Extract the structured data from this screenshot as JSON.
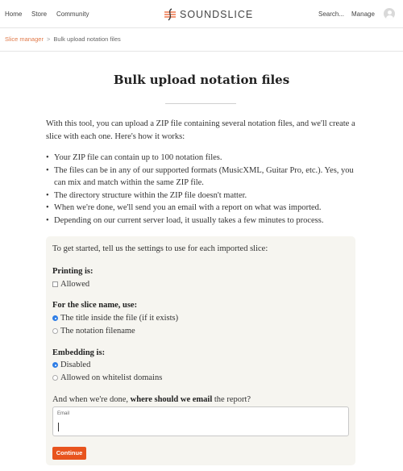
{
  "nav": {
    "home": "Home",
    "store": "Store",
    "community": "Community",
    "brand": "SOUNDSLICE",
    "search": "Search...",
    "manage": "Manage"
  },
  "breadcrumb": {
    "parent": "Slice manager",
    "separator": ">",
    "current": "Bulk upload notation files"
  },
  "page": {
    "title": "Bulk upload notation files",
    "intro": "With this tool, you can upload a ZIP file containing several notation files, and we'll create a slice with each one. Here's how it works:",
    "rules": [
      "Your ZIP file can contain up to 100 notation files.",
      "The files can be in any of our supported formats (MusicXML, Guitar Pro, etc.). Yes, you can mix and match within the same ZIP file.",
      "The directory structure within the ZIP file doesn't matter.",
      "When we're done, we'll send you an email with a report on what was imported.",
      "Depending on our current server load, it usually takes a few minutes to process."
    ]
  },
  "form": {
    "intro": "To get started, tell us the settings to use for each imported slice:",
    "printing": {
      "heading": "Printing is:",
      "option": "Allowed",
      "checked": false
    },
    "slice_name": {
      "heading": "For the slice name, use:",
      "options": [
        "The title inside the file (if it exists)",
        "The notation filename"
      ],
      "selected": 0
    },
    "embedding": {
      "heading": "Embedding is:",
      "options": [
        "Disabled",
        "Allowed on whitelist domains"
      ],
      "selected": 0
    },
    "email_question_pre": "And when we're done,",
    "email_question_bold": "where should we email",
    "email_question_post": "the report?",
    "email_label": "Email",
    "email_value": "",
    "continue": "Continue"
  },
  "colors": {
    "accent": "#e8541e",
    "link": "#e07a4a",
    "radio_selected": "#2f7ee6",
    "panel_bg": "#f6f5f0"
  }
}
